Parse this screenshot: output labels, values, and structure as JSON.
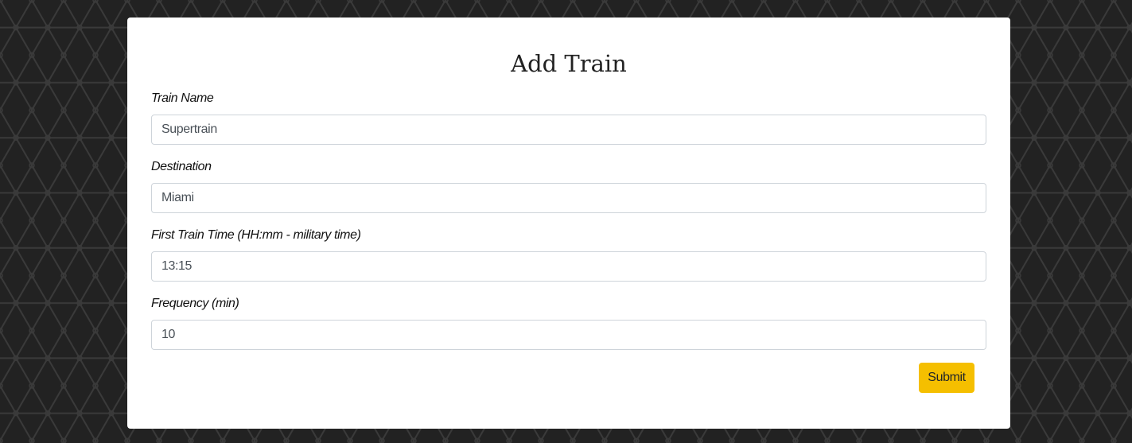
{
  "form": {
    "title": "Add Train",
    "fields": [
      {
        "label": "Train Name",
        "value": "Supertrain"
      },
      {
        "label": "Destination",
        "value": "Miami"
      },
      {
        "label": "First Train Time (HH:mm - military time)",
        "value": "13:15"
      },
      {
        "label": "Frequency (min)",
        "value": "10"
      }
    ],
    "submit_label": "Submit"
  },
  "colors": {
    "background": "#222222",
    "pattern_line": "#3a3a3a",
    "card": "#ffffff",
    "submit_button": "#f5bf00",
    "input_border": "#ced4da"
  }
}
